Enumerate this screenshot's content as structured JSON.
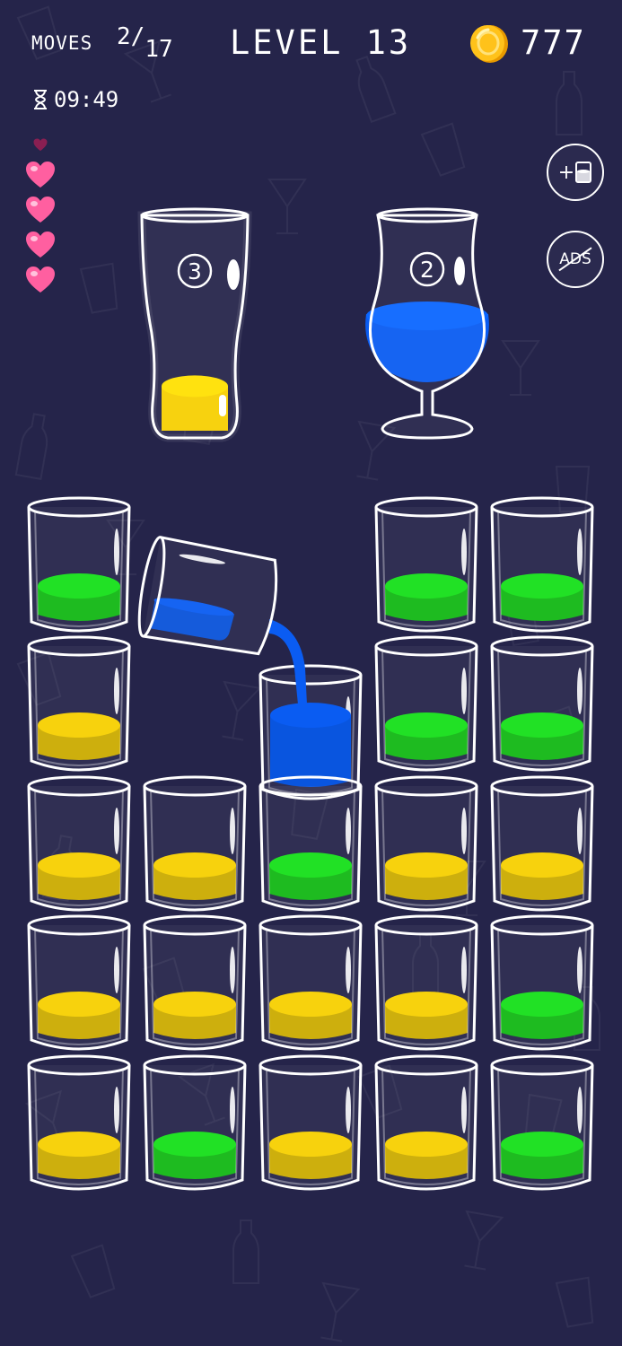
{
  "header": {
    "moves_label": "MOVES",
    "moves_used": "2",
    "moves_total": "17",
    "level_title": "LEVEL 13",
    "coins": "777",
    "timer": "09:49"
  },
  "lives": {
    "full_hearts": 4,
    "small_hearts": 1
  },
  "side_buttons": {
    "add_tube_label": "+",
    "no_ads_label": "ADS"
  },
  "colors": {
    "yellow": "#f7d000",
    "green": "#16e01a",
    "blue": "#0a5cf2",
    "background": "#25244a",
    "heart": "#ff5fa0",
    "coin": "#ffc21a"
  },
  "goals": [
    {
      "type": "pint",
      "badge": "3",
      "liquid": "yellow",
      "fill": 0.2
    },
    {
      "type": "tulip",
      "badge": "2",
      "liquid": "blue",
      "fill": 0.55
    }
  ],
  "grid": {
    "rows": [
      [
        "green",
        "empty",
        "empty",
        "green",
        "green"
      ],
      [
        "yellow",
        "empty",
        "blue-tall",
        "green",
        "green"
      ],
      [
        "yellow",
        "yellow",
        "green",
        "yellow",
        "yellow"
      ],
      [
        "yellow",
        "yellow",
        "yellow",
        "yellow",
        "green"
      ],
      [
        "yellow",
        "green",
        "yellow",
        "yellow",
        "green"
      ]
    ],
    "pouring_cup": {
      "liquid": "blue",
      "row": 0,
      "col": 1
    }
  }
}
